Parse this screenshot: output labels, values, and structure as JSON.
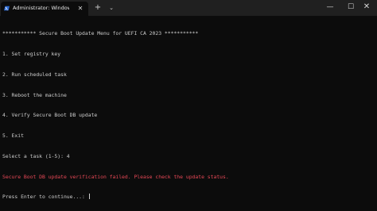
{
  "window": {
    "tab": {
      "title": "Administrator: Windows Pow",
      "icon": "powershell-icon",
      "close_glyph": "✕"
    },
    "new_tab_glyph": "+",
    "dropdown_glyph": "⌄",
    "controls": {
      "minimize": "—",
      "maximize": "☐",
      "close": "✕"
    }
  },
  "colors": {
    "background": "#0c0c0c",
    "titlebar": "#202020",
    "text": "#cccccc",
    "error": "#e74856"
  },
  "console": {
    "header": "*********** Secure Boot Update Menu for UEFI CA 2023 ***********",
    "menu": [
      "1. Set registry key",
      "2. Run scheduled task",
      "3. Reboot the machine",
      "4. Verify Secure Boot DB update",
      "5. Exit"
    ],
    "prompt": "Select a task (1-5): 4",
    "error": "Secure Boot DB update verification failed. Please check the update status.",
    "continue_prompt": "Press Enter to continue...: "
  }
}
